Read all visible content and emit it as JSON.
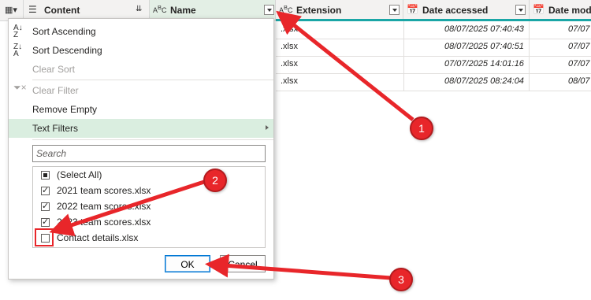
{
  "header": {
    "columns": [
      {
        "label": "Content"
      },
      {
        "label": "Name"
      },
      {
        "label": "Extension"
      },
      {
        "label": "Date accessed"
      },
      {
        "label": "Date modi"
      }
    ]
  },
  "rows": [
    {
      "ext": ".xlsx",
      "accessed": "08/07/2025 07:40:43",
      "modified": "07/07"
    },
    {
      "ext": ".xlsx",
      "accessed": "08/07/2025 07:40:51",
      "modified": "07/07"
    },
    {
      "ext": ".xlsx",
      "accessed": "07/07/2025 14:01:16",
      "modified": "07/07"
    },
    {
      "ext": ".xlsx",
      "accessed": "08/07/2025 08:24:04",
      "modified": "08/07"
    }
  ],
  "menu": {
    "sort_ascending": "Sort Ascending",
    "sort_descending": "Sort Descending",
    "clear_sort": "Clear Sort",
    "clear_filter": "Clear Filter",
    "remove_empty": "Remove Empty",
    "text_filters": "Text Filters",
    "search_placeholder": "Search",
    "items": [
      {
        "label": "(Select All)",
        "state": "partial"
      },
      {
        "label": "2021 team scores.xlsx",
        "state": "checked"
      },
      {
        "label": "2022 team scores.xlsx",
        "state": "checked"
      },
      {
        "label": "2023 team scores.xlsx",
        "state": "checked"
      },
      {
        "label": "Contact details.xlsx",
        "state": "unchecked"
      }
    ],
    "ok_label": "OK",
    "cancel_label": "Cancel"
  },
  "annotations": [
    "1",
    "2",
    "3"
  ],
  "colors": {
    "accent": "#1aa6a6",
    "annotation_red": "#e8262a",
    "highlight": "#daeee0"
  }
}
